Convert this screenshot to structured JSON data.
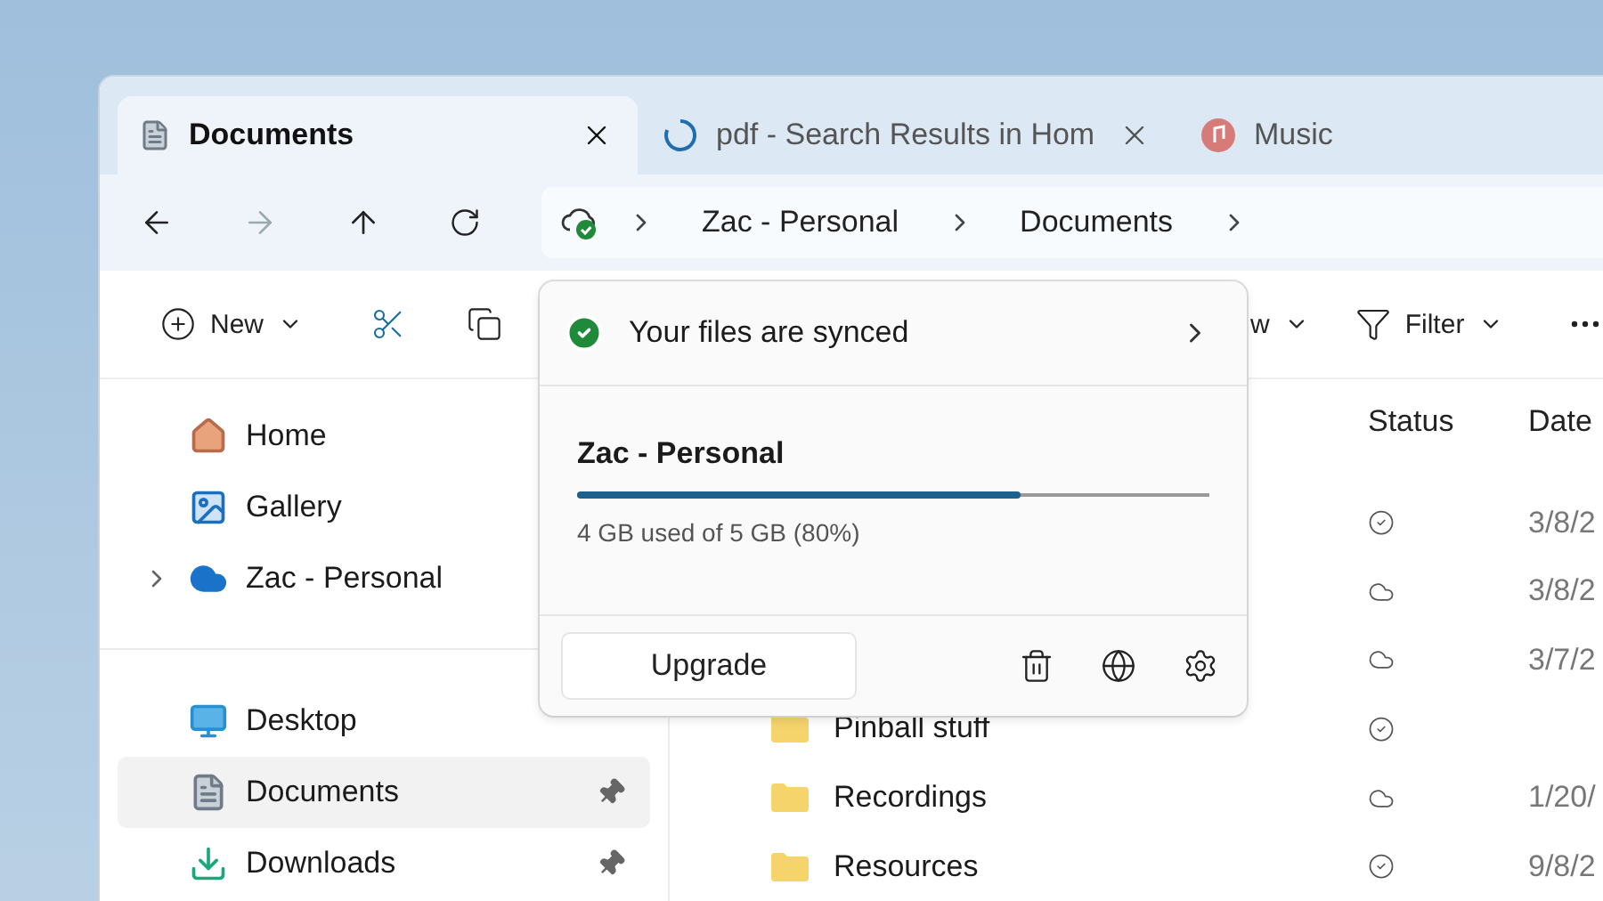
{
  "tabs": [
    {
      "kind": "documents",
      "label": "Documents",
      "selected": true,
      "closable": true
    },
    {
      "kind": "loading",
      "label": "pdf - Search Results in Hom",
      "selected": false,
      "closable": true
    },
    {
      "kind": "music",
      "label": "Music",
      "selected": false,
      "closable": false
    }
  ],
  "nav": {
    "forward_disabled": true
  },
  "breadcrumb": [
    "Zac - Personal",
    "Documents"
  ],
  "toolbar": {
    "new_label": "New",
    "view_label": "w",
    "filter_label": "Filter"
  },
  "sidebar": {
    "top": [
      {
        "kind": "home",
        "label": "Home",
        "expandable": false,
        "selected": false
      },
      {
        "kind": "gallery",
        "label": "Gallery",
        "expandable": false,
        "selected": false
      },
      {
        "kind": "cloud",
        "label": "Zac - Personal",
        "expandable": true,
        "selected": false
      }
    ],
    "pinned": [
      {
        "kind": "desktop",
        "label": "Desktop",
        "selected": false
      },
      {
        "kind": "documents",
        "label": "Documents",
        "pinned": true,
        "selected": true
      },
      {
        "kind": "downloads",
        "label": "Downloads",
        "pinned": true,
        "selected": false
      }
    ]
  },
  "columns": [
    "Status",
    "Date"
  ],
  "rows": [
    {
      "kind": "synced",
      "date": "3/8/2"
    },
    {
      "kind": "cloud",
      "date": "3/8/2"
    },
    {
      "kind": "cloud",
      "date": "3/7/2"
    },
    {
      "name": "Pinball stuff",
      "kind": "synced"
    },
    {
      "name": "Recordings",
      "kind": "cloud",
      "date": "1/20/"
    },
    {
      "name": "Resources",
      "kind": "synced",
      "date": "9/8/2"
    }
  ],
  "sync_popup": {
    "status": "Your files are synced",
    "account": "Zac - Personal",
    "storage": {
      "level": 0.7,
      "reading": "4 GB used of 5 GB (80%)"
    },
    "upgrade_label": "Upgrade"
  }
}
